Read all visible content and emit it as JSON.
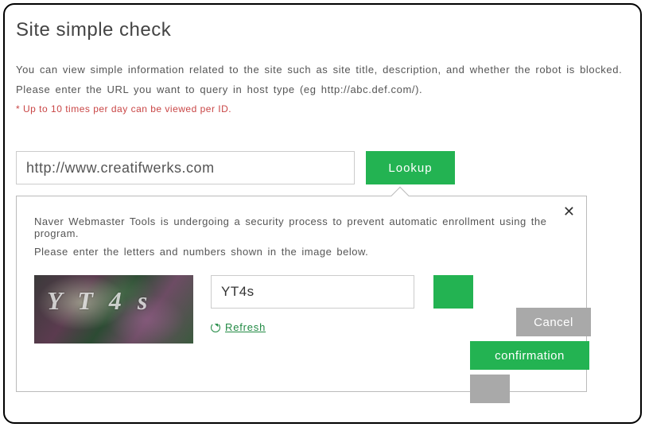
{
  "page": {
    "title": "Site simple check",
    "intro_line1": "You can view simple information related to the site such as site title, description, and whether the robot is blocked.",
    "intro_line2": "Please enter the URL you want to query in host type (eg http://abc.def.com/).",
    "limit_note": "* Up to 10 times per day can be viewed per ID."
  },
  "search": {
    "url_value": "http://www.creatifwerks.com",
    "lookup_label": "Lookup"
  },
  "captcha": {
    "message_line1": "Naver Webmaster Tools is undergoing a security process to prevent automatic enrollment using the program.",
    "message_line2": "Please enter the letters and numbers shown in the image below.",
    "image_text": "Y T 4 s",
    "input_value": "YT4s",
    "refresh_label": "Refresh",
    "cancel_label": "Cancel",
    "confirm_label": "confirmation",
    "close_label": "✕"
  }
}
